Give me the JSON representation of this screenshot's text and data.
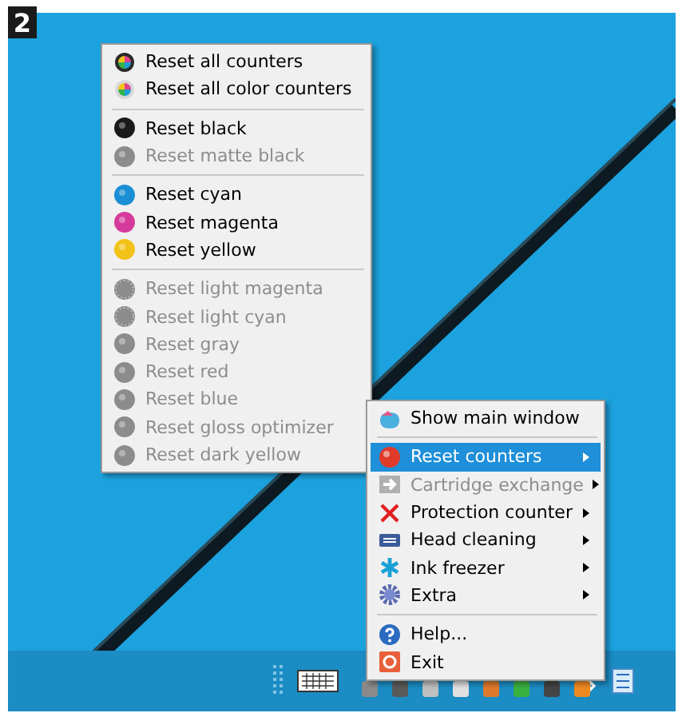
{
  "figure_label": "2",
  "counter_menu": {
    "groups": [
      [
        {
          "label": "Reset all counters",
          "kind": "multi",
          "color": "#2a2a2a",
          "disabled": false
        },
        {
          "label": "Reset all color counters",
          "kind": "multi",
          "color": "#d8d8d8",
          "disabled": false
        }
      ],
      [
        {
          "label": "Reset black",
          "kind": "ball",
          "color": "#1a1a1a",
          "disabled": false
        },
        {
          "label": "Reset matte black",
          "kind": "ball",
          "color": "#8c8c8c",
          "disabled": true
        }
      ],
      [
        {
          "label": "Reset cyan",
          "kind": "ball",
          "color": "#1a8fd6",
          "disabled": false
        },
        {
          "label": "Reset magenta",
          "kind": "ball",
          "color": "#d63a9a",
          "disabled": false
        },
        {
          "label": "Reset yellow",
          "kind": "ball",
          "color": "#f2c21a",
          "disabled": false
        }
      ],
      [
        {
          "label": "Reset light magenta",
          "kind": "dotted",
          "color": "#8c8c8c",
          "disabled": true
        },
        {
          "label": "Reset light cyan",
          "kind": "dotted",
          "color": "#8c8c8c",
          "disabled": true
        },
        {
          "label": "Reset gray",
          "kind": "ball",
          "color": "#8c8c8c",
          "disabled": true
        },
        {
          "label": "Reset red",
          "kind": "ball",
          "color": "#8c8c8c",
          "disabled": true
        },
        {
          "label": "Reset blue",
          "kind": "ball",
          "color": "#8c8c8c",
          "disabled": true
        },
        {
          "label": "Reset gloss optimizer",
          "kind": "ball",
          "color": "#8c8c8c",
          "disabled": true
        },
        {
          "label": "Reset dark yellow",
          "kind": "ball",
          "color": "#8c8c8c",
          "disabled": true
        }
      ]
    ]
  },
  "tray_menu": {
    "groups": [
      [
        {
          "label": "Show main window",
          "kind": "show",
          "submenu": false,
          "disabled": false,
          "selected": false
        }
      ],
      [
        {
          "label": "Reset counters",
          "kind": "reset",
          "submenu": true,
          "disabled": false,
          "selected": true
        },
        {
          "label": "Cartridge exchange",
          "kind": "arrow",
          "submenu": true,
          "disabled": true,
          "selected": false
        },
        {
          "label": "Protection counter",
          "kind": "cross",
          "submenu": true,
          "disabled": false,
          "selected": false
        },
        {
          "label": "Head cleaning",
          "kind": "head",
          "submenu": true,
          "disabled": false,
          "selected": false
        },
        {
          "label": "Ink freezer",
          "kind": "freezer",
          "submenu": true,
          "disabled": false,
          "selected": false
        },
        {
          "label": "Extra",
          "kind": "gear",
          "submenu": true,
          "disabled": false,
          "selected": false
        }
      ],
      [
        {
          "label": "Help...",
          "kind": "help",
          "submenu": false,
          "disabled": false,
          "selected": false
        },
        {
          "label": "Exit",
          "kind": "exit",
          "submenu": false,
          "disabled": false,
          "selected": false
        }
      ]
    ]
  }
}
